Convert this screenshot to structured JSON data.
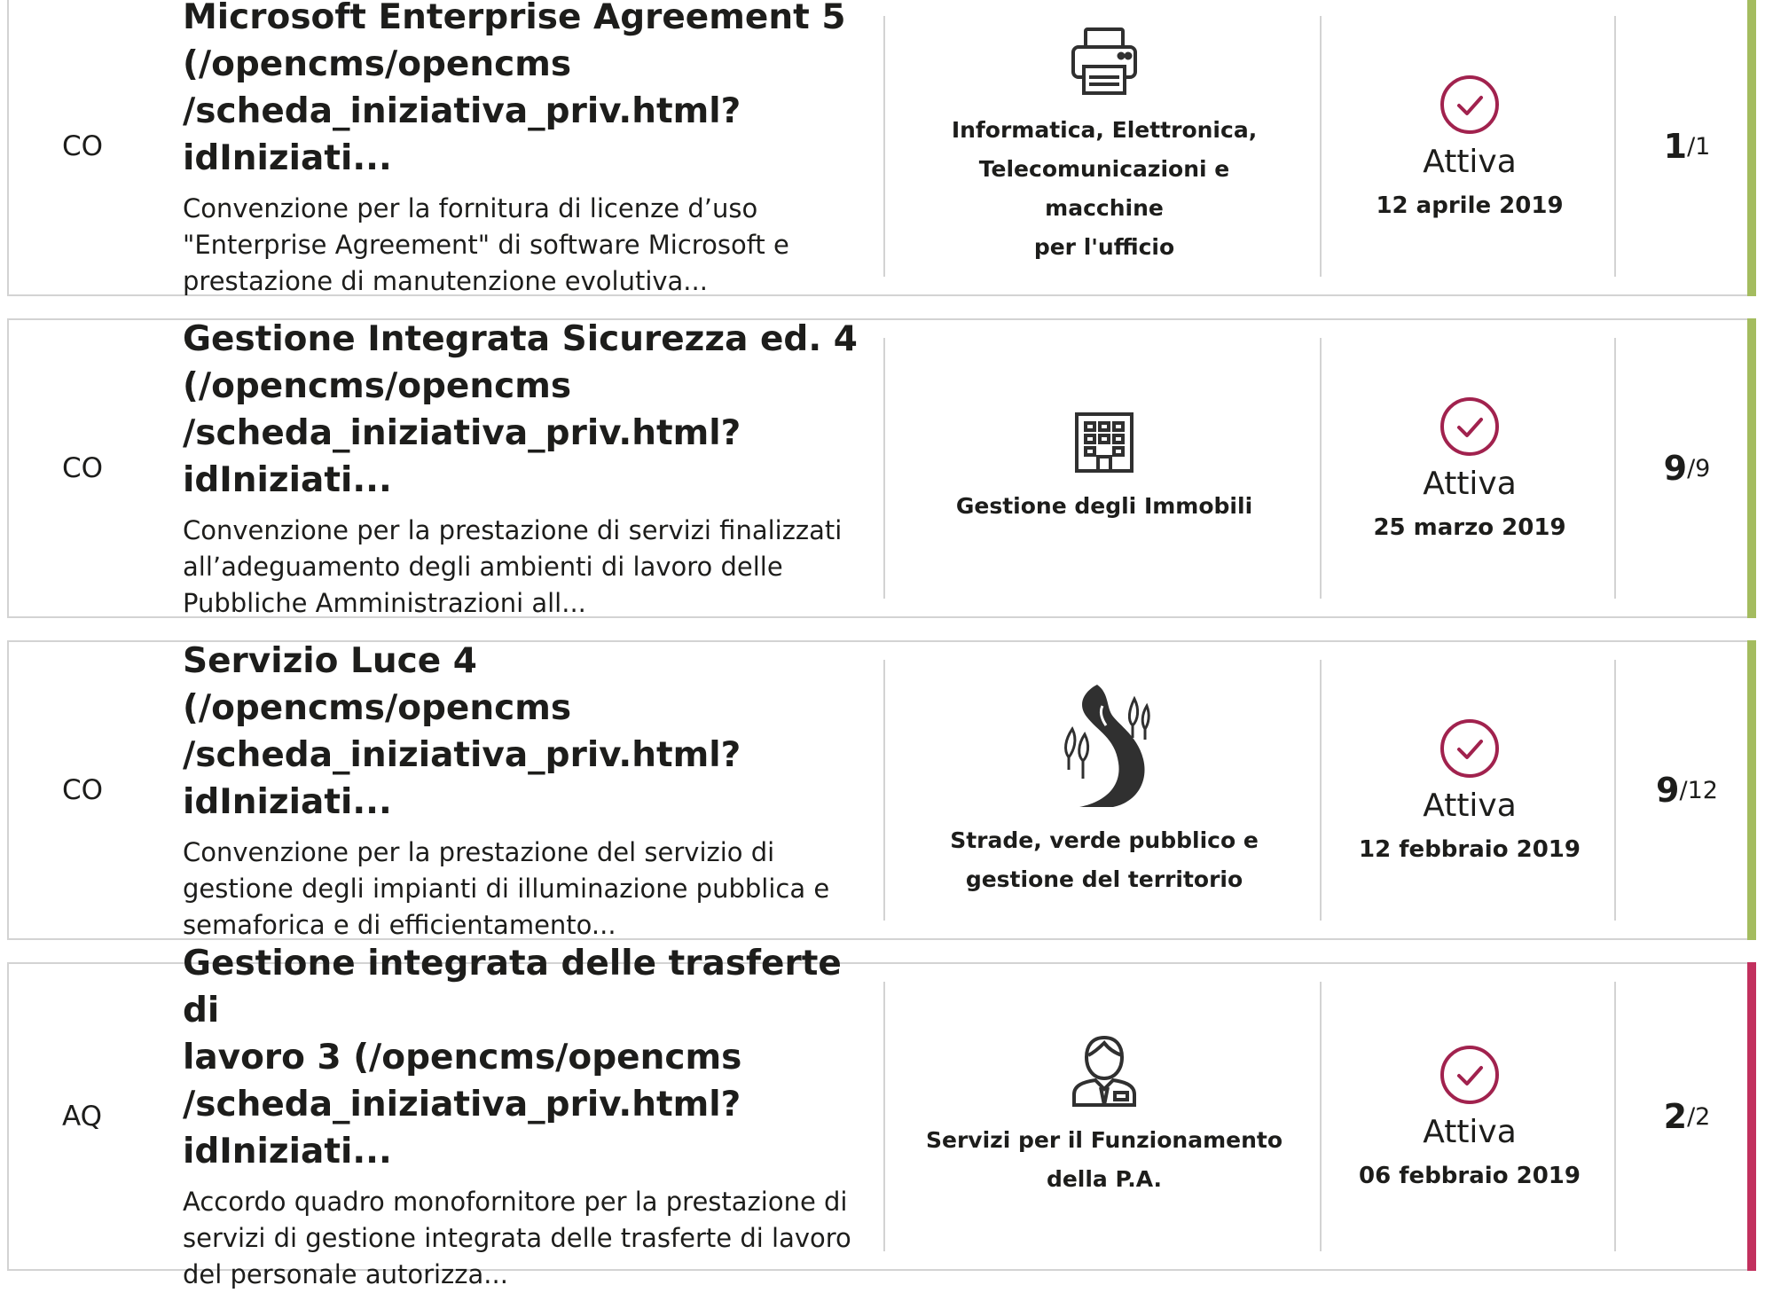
{
  "colors": {
    "active_stripe": "#a4bc5f",
    "aq_stripe": "#c2305e",
    "check_color": "#a1224e",
    "icon_color": "#303030"
  },
  "cards": [
    {
      "type": "CO",
      "title": "Microsoft Enterprise Agreement 5 (/opencms/opencms /scheda_iniziativa_priv.html?idIniziati...",
      "title_lines": [
        "Microsoft Enterprise Agreement 5",
        "(/opencms/opencms",
        "/scheda_iniziativa_priv.html?idIniziati..."
      ],
      "description_lines": [
        "Convenzione per la fornitura di licenze d’uso",
        "\"Enterprise Agreement\" di software Microsoft e",
        "prestazione di manutenzione evolutiva..."
      ],
      "category_icon": "printer-icon",
      "category_lines": [
        "Informatica, Elettronica,",
        "Telecomunicazioni e macchine",
        "per l'ufficio"
      ],
      "status": "Attiva",
      "date": "12 aprile 2019",
      "count_a": "1",
      "count_b": "/1",
      "stripe": "active"
    },
    {
      "type": "CO",
      "title_lines": [
        "Gestione Integrata Sicurezza ed. 4",
        "(/opencms/opencms",
        "/scheda_iniziativa_priv.html?idIniziati..."
      ],
      "description_lines": [
        "Convenzione per la prestazione di servizi finalizzati",
        "all’adeguamento degli ambienti di lavoro delle",
        "Pubbliche Amministrazioni all..."
      ],
      "category_icon": "building-icon",
      "category_lines": [
        "Gestione degli Immobili"
      ],
      "status": "Attiva",
      "date": "25 marzo 2019",
      "count_a": "9",
      "count_b": "/9",
      "stripe": "active"
    },
    {
      "type": "CO",
      "title_lines": [
        "Servizio Luce 4 (/opencms/opencms",
        "/scheda_iniziativa_priv.html?idIniziati..."
      ],
      "description_lines": [
        "Convenzione per la prestazione del servizio di",
        "gestione degli impianti di illuminazione pubblica e",
        "semaforica e di efficientamento..."
      ],
      "category_icon": "road-trees-icon",
      "category_lines": [
        "Strade, verde pubblico e",
        "gestione del territorio"
      ],
      "status": "Attiva",
      "date": "12 febbraio 2019",
      "count_a": "9",
      "count_b": "/12",
      "stripe": "active"
    },
    {
      "type": "AQ",
      "title_lines": [
        "Gestione integrata delle trasferte di",
        "lavoro 3 (/opencms/opencms",
        "/scheda_iniziativa_priv.html?idIniziati..."
      ],
      "description_lines": [
        "Accordo quadro monofornitore per la prestazione di",
        "servizi di gestione integrata delle trasferte di lavoro",
        "del personale autorizza..."
      ],
      "category_icon": "person-icon",
      "category_lines": [
        "Servizi per il Funzionamento",
        "della P.A."
      ],
      "status": "Attiva",
      "date": "06 febbraio 2019",
      "count_a": "2",
      "count_b": "/2",
      "stripe": "aq"
    }
  ]
}
